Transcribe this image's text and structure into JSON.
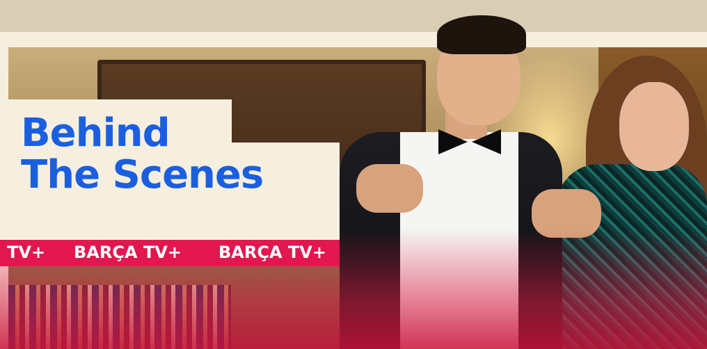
{
  "banner": {
    "title_line1": "Behind",
    "title_line2": "The Scenes",
    "ticker": [
      "TV+",
      "BARÇA TV+",
      "BARÇA TV+"
    ]
  },
  "colors": {
    "title": "#1b5fe0",
    "ticker_bg": "#e2174f",
    "card_bg": "#f6efdf"
  }
}
